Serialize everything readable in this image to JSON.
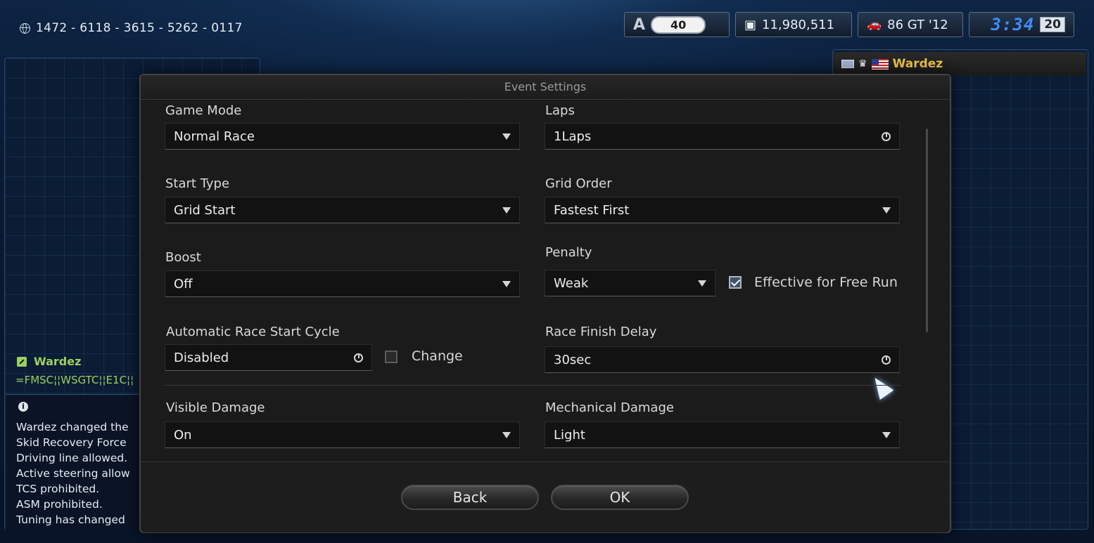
{
  "lobby": {
    "id": "1472 - 6118 - 3615 - 5262 - 0117"
  },
  "hud": {
    "rank_letter": "A",
    "level": "40",
    "credits": "11,980,511",
    "car": "86 GT '12",
    "clock": "3:34",
    "day": "20"
  },
  "player": {
    "name": "Wardez"
  },
  "chat": {
    "sender": "Wardez",
    "message": "=FMSC¦¦WSGTC¦¦E1C¦¦",
    "system_lines": [
      "Wardez changed the",
      "Skid Recovery Force",
      "Driving line allowed.",
      "Active steering allow",
      "TCS prohibited.",
      "ASM prohibited.",
      "Tuning has changed"
    ]
  },
  "dialog": {
    "title": "Event Settings",
    "fields": {
      "game_mode": {
        "label": "Game Mode",
        "value": "Normal Race"
      },
      "laps": {
        "label": "Laps",
        "value": "1Laps"
      },
      "start_type": {
        "label": "Start Type",
        "value": "Grid Start"
      },
      "grid_order": {
        "label": "Grid Order",
        "value": "Fastest First"
      },
      "boost": {
        "label": "Boost",
        "value": "Off"
      },
      "penalty": {
        "label": "Penalty",
        "value": "Weak"
      },
      "free_run": {
        "label": "Effective for Free Run",
        "checked": true
      },
      "auto_start": {
        "label": "Automatic Race Start Cycle",
        "value": "Disabled"
      },
      "change": {
        "label": "Change",
        "checked": false
      },
      "finish_delay": {
        "label": "Race Finish Delay",
        "value": "30sec"
      },
      "visible_damage": {
        "label": "Visible Damage",
        "value": "On"
      },
      "mech_damage": {
        "label": "Mechanical Damage",
        "value": "Light"
      }
    },
    "buttons": {
      "back": "Back",
      "ok": "OK"
    }
  },
  "colors": {
    "accent_blue": "#3f8cff",
    "chat_green": "#9cd05f",
    "player_gold": "#ecc24a"
  }
}
